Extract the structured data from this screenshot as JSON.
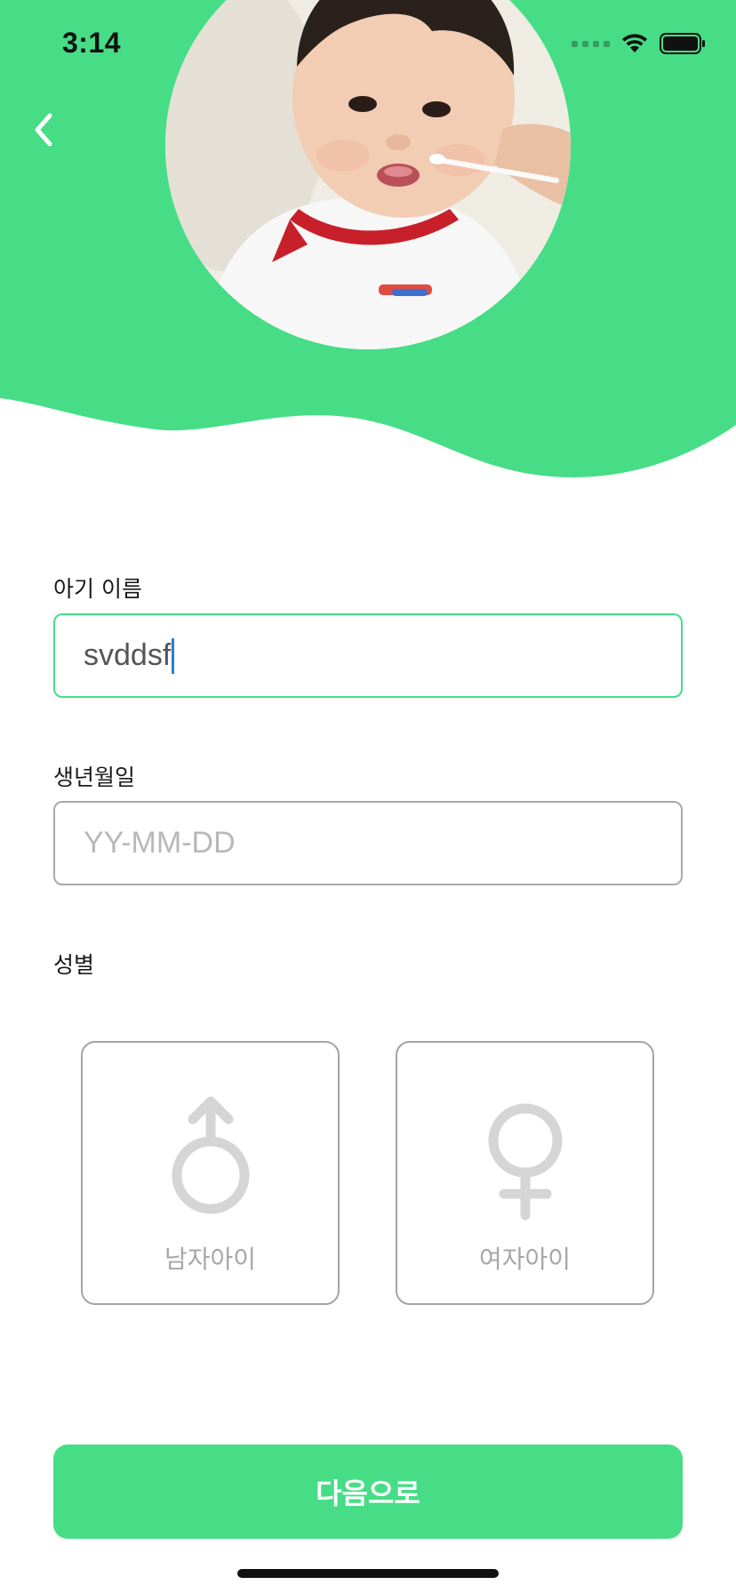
{
  "status_bar": {
    "time": "3:14",
    "icons": [
      "signal-icon",
      "wifi-icon",
      "battery-icon"
    ]
  },
  "header": {
    "accent_color": "#46dd86",
    "back_icon": "chevron-left-icon",
    "photo": "baby-photo"
  },
  "form": {
    "name_label": "아기 이름",
    "name_value": "svddsf",
    "birth_label": "생년월일",
    "birth_placeholder": "YY-MM-DD",
    "gender_label": "성별",
    "male_label": "남자아이",
    "female_label": "여자아이",
    "male_icon": "male-symbol-icon",
    "female_icon": "female-symbol-icon"
  },
  "next_button": {
    "label": "다음으로"
  }
}
